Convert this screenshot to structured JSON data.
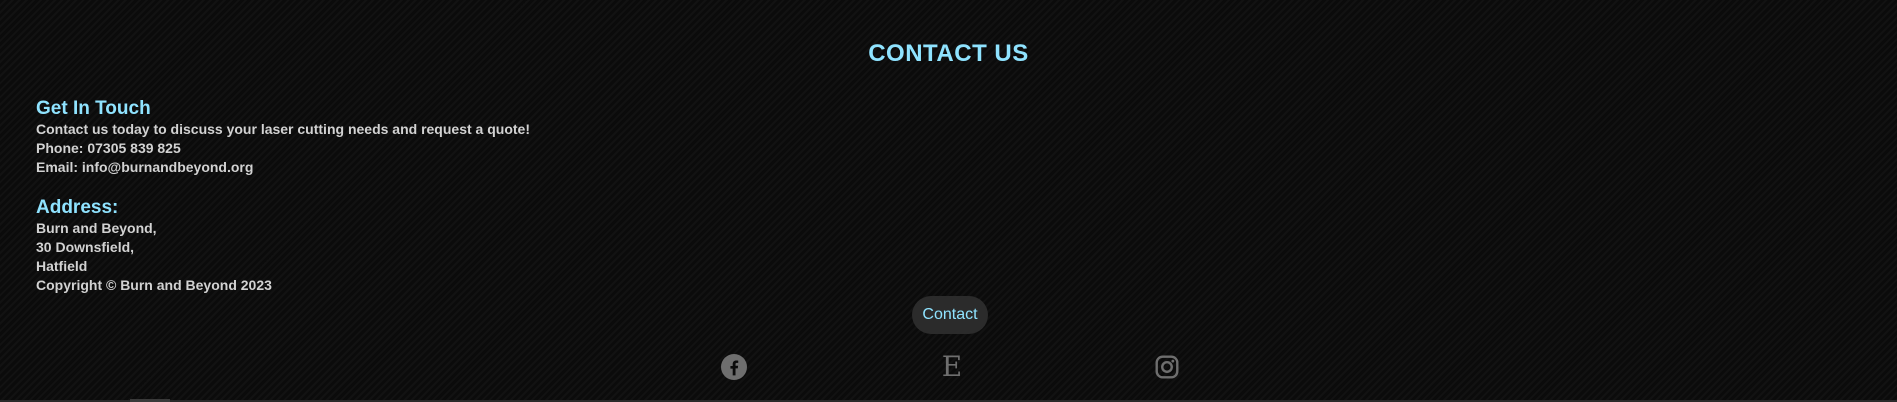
{
  "section": {
    "title": "CONTACT US"
  },
  "get_in_touch": {
    "heading": "Get In Touch",
    "intro": "Contact us today to discuss your laser cutting needs and request a quote!",
    "phone": "Phone: 07305 839 825",
    "email": "Email: info@burnandbeyond.org"
  },
  "address": {
    "heading": "Address:",
    "lines": [
      "Burn and Beyond,",
      "30 Downsfield,",
      "Hatfield"
    ],
    "copyright": "Copyright © Burn and Beyond 2023"
  },
  "contact_button": {
    "label": "Contact"
  },
  "social": {
    "icons": [
      "facebook-icon",
      "etsy-icon",
      "instagram-icon"
    ],
    "etsy_letter": "E",
    "icon_color": "#6e6e6e"
  },
  "colors": {
    "accent": "#8fe3ff",
    "background": "#0b0b0b",
    "text": "#d2d2d2",
    "pill": "#2b2b2b"
  }
}
